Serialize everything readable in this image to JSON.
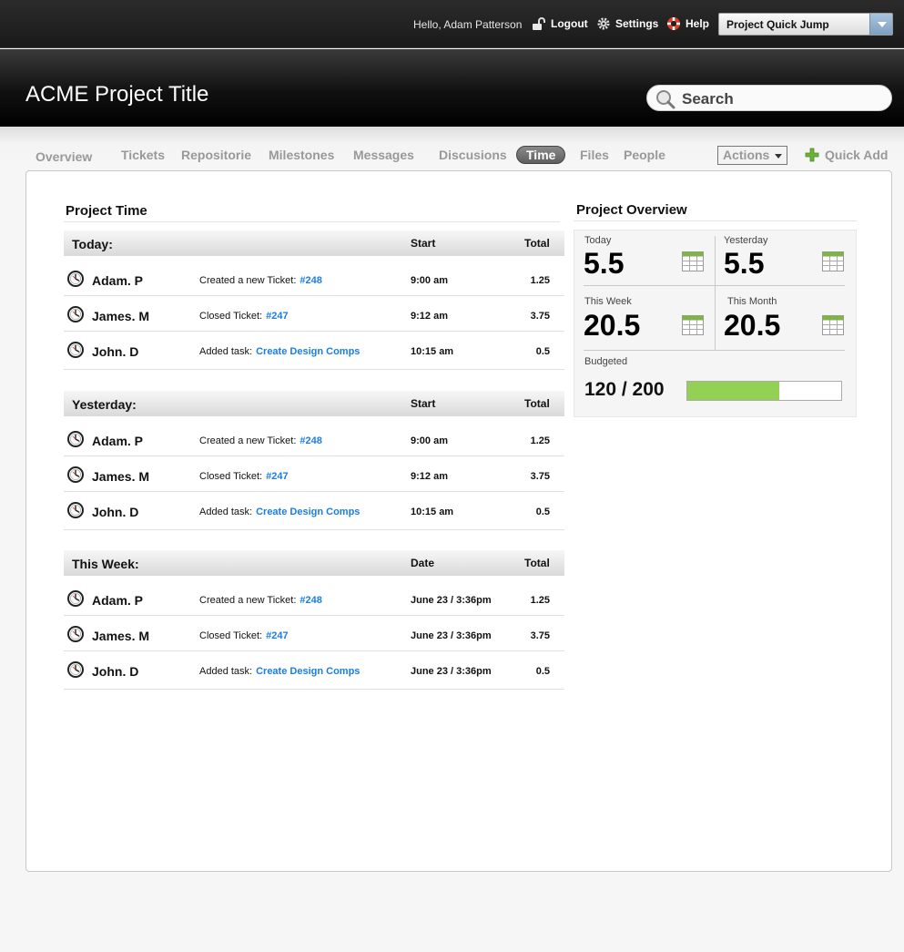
{
  "topbar": {
    "greeting": "Hello, Adam Patterson",
    "logout": "Logout",
    "settings": "Settings",
    "help": "Help",
    "quick_jump": "Project Quick Jump"
  },
  "header": {
    "title": "ACME Project Title",
    "search_placeholder": "Search"
  },
  "nav": {
    "items": [
      "Overview",
      "Tickets",
      "Repositorie",
      "Milestones",
      "Messages",
      "Discusions",
      "Time",
      "Files",
      "People"
    ],
    "active": "Time",
    "actions": "Actions",
    "quick_add": "Quick Add"
  },
  "project_time": {
    "title": "Project Time",
    "groups": [
      {
        "name": "Today:",
        "col1": "Start",
        "col2": "Total",
        "rows": [
          {
            "name": "Adam. P",
            "action": "Created a new Ticket:",
            "link": "#248",
            "time": "9:00 am",
            "total": "1.25"
          },
          {
            "name": "James. M",
            "action": "Closed Ticket:",
            "link": "#247",
            "time": "9:12 am",
            "total": "3.75"
          },
          {
            "name": "John. D",
            "action": "Added task:",
            "link": "Create Design Comps",
            "time": "10:15 am",
            "total": "0.5"
          }
        ]
      },
      {
        "name": "Yesterday:",
        "col1": "Start",
        "col2": "Total",
        "rows": [
          {
            "name": "Adam. P",
            "action": "Created a new Ticket:",
            "link": "#248",
            "time": "9:00 am",
            "total": "1.25"
          },
          {
            "name": "James. M",
            "action": "Closed Ticket:",
            "link": "#247",
            "time": "9:12 am",
            "total": "3.75"
          },
          {
            "name": "John. D",
            "action": "Added task:",
            "link": "Create Design Comps",
            "time": "10:15 am",
            "total": "0.5"
          }
        ]
      },
      {
        "name": "This Week:",
        "col1": "Date",
        "col2": "Total",
        "rows": [
          {
            "name": "Adam. P",
            "action": "Created a new Ticket:",
            "link": "#248",
            "time": "June 23 / 3:36pm",
            "total": "1.25"
          },
          {
            "name": "James. M",
            "action": "Closed Ticket:",
            "link": "#247",
            "time": "June 23 / 3:36pm",
            "total": "3.75"
          },
          {
            "name": "John. D",
            "action": "Added task:",
            "link": "Create Design Comps",
            "time": "June 23 / 3:36pm",
            "total": "0.5"
          }
        ]
      }
    ]
  },
  "overview": {
    "title": "Project Overview",
    "today_label": "Today",
    "today_value": "5.5",
    "yesterday_label": "Yesterday",
    "yesterday_value": "5.5",
    "week_label": "This Week",
    "week_value": "20.5",
    "month_label": "This Month",
    "month_value": "20.5",
    "budget_label": "Budgeted",
    "budget_value": "120 / 200",
    "budget_fraction": 0.6
  },
  "colors": {
    "link": "#1a7ee6",
    "budget_bar": "#93d155",
    "active_tab": "#6e6e6e"
  }
}
